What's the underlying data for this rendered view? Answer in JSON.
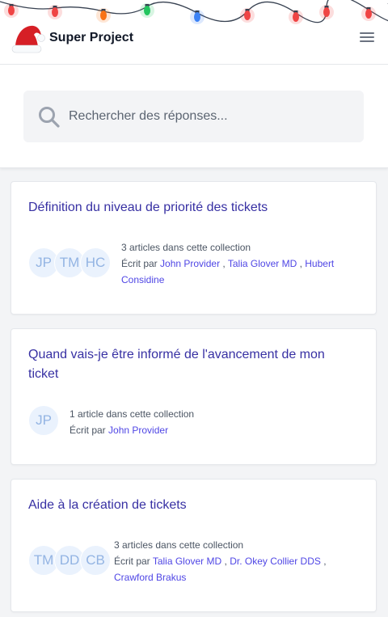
{
  "header": {
    "brand_name": "Super Project",
    "logo_icon": "santa-hat-icon",
    "menu_icon": "hamburger-menu-icon",
    "decoration": "christmas-lights",
    "light_colors": [
      "#ef4444",
      "#ef4444",
      "#f97316",
      "#22c55e",
      "#3b82f6",
      "#ef4444",
      "#ef4444",
      "#ef4444",
      "#ef4444"
    ]
  },
  "search": {
    "placeholder": "Rechercher des réponses...",
    "value": ""
  },
  "collections": [
    {
      "title": "Définition du niveau de priorité des tickets",
      "count_text": "3 articles dans cette collection",
      "written_by": "Écrit par",
      "avatars": [
        "JP",
        "TM",
        "HC"
      ],
      "authors": [
        "John Provider",
        "Talia Glover MD",
        "Hubert Considine"
      ]
    },
    {
      "title": "Quand vais-je être informé de l'avancement de mon ticket",
      "count_text": "1 article dans cette collection",
      "written_by": "Écrit par",
      "avatars": [
        "JP"
      ],
      "authors": [
        "John Provider"
      ]
    },
    {
      "title": "Aide à la création de tickets",
      "count_text": "3 articles dans cette collection",
      "written_by": "Écrit par",
      "avatars": [
        "TM",
        "DD",
        "CB"
      ],
      "authors": [
        "Talia Glover MD",
        "Dr. Okey Collier DDS",
        "Crawford Brakus"
      ]
    }
  ],
  "colors": {
    "title": "#3730a3",
    "link": "#4f46e5",
    "avatar_bg": "#eaf2fd",
    "avatar_text": "#93b4e3"
  }
}
